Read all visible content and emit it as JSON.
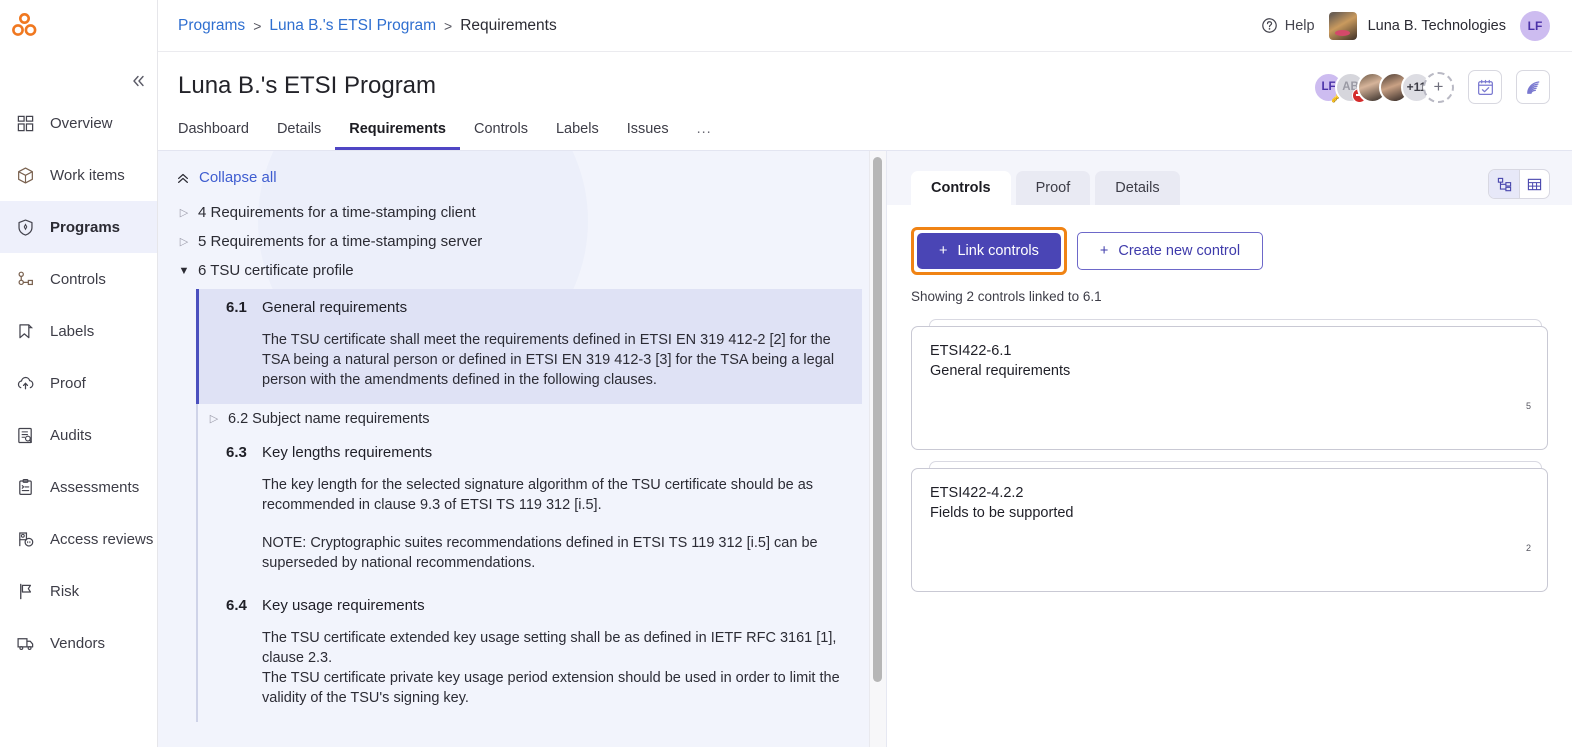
{
  "sidebar": {
    "logo": "orbit-logo",
    "collapse_icon": "chevron-double-left-icon",
    "items": [
      {
        "label": "Overview",
        "icon": "dashboard-grid-icon",
        "active": false
      },
      {
        "label": "Work items",
        "icon": "box-icon",
        "active": false
      },
      {
        "label": "Programs",
        "icon": "shield-icon",
        "active": true
      },
      {
        "label": "Controls",
        "icon": "nodes-icon",
        "active": false
      },
      {
        "label": "Labels",
        "icon": "bookmark-icon",
        "active": false
      },
      {
        "label": "Proof",
        "icon": "cloud-upload-icon",
        "active": false
      },
      {
        "label": "Audits",
        "icon": "document-search-icon",
        "active": false
      },
      {
        "label": "Assessments",
        "icon": "clipboard-list-icon",
        "active": false
      },
      {
        "label": "Access reviews",
        "icon": "key-badge-icon",
        "active": false
      },
      {
        "label": "Risk",
        "icon": "flag-icon",
        "active": false
      },
      {
        "label": "Vendors",
        "icon": "truck-icon",
        "active": false
      }
    ]
  },
  "topbar": {
    "breadcrumb": [
      {
        "label": "Programs",
        "link": true
      },
      {
        "label": "Luna B.'s ETSI Program",
        "link": true
      },
      {
        "label": "Requirements",
        "link": false
      }
    ],
    "separator": ">",
    "help_label": "Help",
    "help_icon": "question-circle-icon",
    "org_name": "Luna B. Technologies",
    "org_avatar": "dog-photo-avatar",
    "user_initials": "LF"
  },
  "page": {
    "title": "Luna B.'s ETSI Program",
    "tabs": [
      {
        "label": "Dashboard",
        "active": false
      },
      {
        "label": "Details",
        "active": false
      },
      {
        "label": "Requirements",
        "active": true
      },
      {
        "label": "Controls",
        "active": false
      },
      {
        "label": "Labels",
        "active": false
      },
      {
        "label": "Issues",
        "active": false
      },
      {
        "label": "...",
        "active": false
      }
    ],
    "avatars": [
      {
        "initials": "LF",
        "kind": "initials-purple",
        "badge": "key-badge"
      },
      {
        "initials": "AB",
        "kind": "initials-grey",
        "badge": "blocked-badge"
      },
      {
        "initials": "",
        "kind": "photo-1",
        "badge": ""
      },
      {
        "initials": "",
        "kind": "photo-2",
        "badge": ""
      },
      {
        "initials": "+11",
        "kind": "overflow",
        "badge": ""
      },
      {
        "initials": "+",
        "kind": "add",
        "badge": ""
      }
    ],
    "header_icons": [
      {
        "name": "calendar-check-icon"
      },
      {
        "name": "rss-feed-icon"
      }
    ]
  },
  "left_pane": {
    "collapse_all_label": "Collapse all",
    "collapse_all_icon": "chevron-double-up-icon",
    "nodes": [
      {
        "label": "4 Requirements for a time-stamping client",
        "expanded": false
      },
      {
        "label": "5 Requirements for a time-stamping server",
        "expanded": false
      },
      {
        "label": "6 TSU certificate profile",
        "expanded": true
      }
    ],
    "requirements": [
      {
        "number": "6.1",
        "name": "General requirements",
        "selected": true,
        "paragraphs": [
          "The TSU certificate shall meet the requirements defined in ETSI EN 319 412-2 [2] for the TSA being a natural person or defined in ETSI EN 319 412-3 [3] for the TSA being a legal person with the amendments defined in the following clauses."
        ]
      },
      {
        "number": "6.2",
        "name": "Subject name requirements",
        "collapsed_child": true,
        "label": "6.2 Subject name requirements",
        "paragraphs": []
      },
      {
        "number": "6.3",
        "name": "Key lengths requirements",
        "selected": false,
        "paragraphs": [
          "The key length for the selected signature algorithm of the TSU certificate should be as recommended in clause 9.3 of ETSI TS 119 312 [i.5].",
          "NOTE: Cryptographic suites recommendations defined in ETSI TS 119 312 [i.5] can be superseded by national recommendations."
        ]
      },
      {
        "number": "6.4",
        "name": "Key usage requirements",
        "selected": false,
        "paragraphs": [
          "The TSU certificate extended key usage setting shall be as defined in IETF RFC 3161 [1], clause 2.3.",
          "The TSU certificate private key usage period extension should be used in order to limit the validity of the TSU's signing key."
        ]
      }
    ]
  },
  "right_pane": {
    "tabs": [
      {
        "label": "Controls",
        "active": true
      },
      {
        "label": "Proof",
        "active": false
      },
      {
        "label": "Details",
        "active": false
      }
    ],
    "view_toggle": [
      {
        "name": "tree-view-icon",
        "active": true
      },
      {
        "name": "table-view-icon",
        "active": false
      }
    ],
    "link_controls_label": "Link controls",
    "create_control_label": "Create new control",
    "plus_icon": "plus-icon",
    "showing_text": "Showing 2 controls linked to 6.1",
    "cards": [
      {
        "id": "ETSI422-6.1",
        "title": "General requirements",
        "count": "5"
      },
      {
        "id": "ETSI422-4.2.2",
        "title": "Fields to be supported",
        "count": "2"
      }
    ]
  },
  "colors": {
    "accent_purple": "#4a45b5",
    "focus_orange": "#f08314",
    "link_blue": "#2f6fd0",
    "logo_orange": "#f07820",
    "selected_bg": "#dfe2f5"
  }
}
